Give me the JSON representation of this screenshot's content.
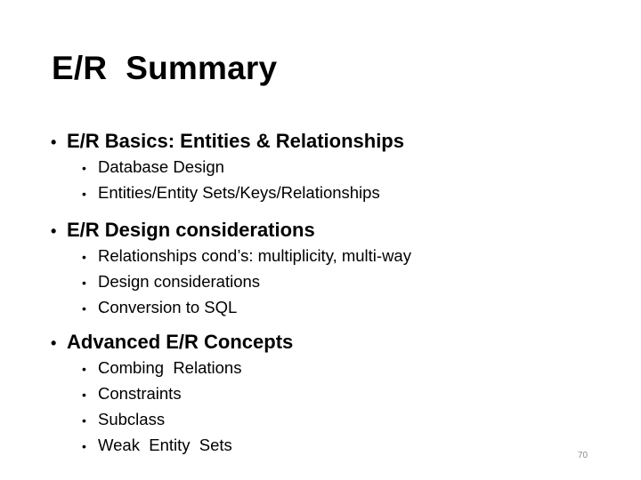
{
  "slide": {
    "title": "E/R  Summary",
    "page_number": "70",
    "sections": [
      {
        "heading": "E/R Basics: Entities & Relationships",
        "items": [
          "Database Design",
          "Entities/Entity Sets/Keys/Relationships"
        ]
      },
      {
        "heading": "E/R Design considerations",
        "items": [
          "Relationships cond’s: multiplicity, multi-way",
          "Design considerations",
          "Conversion to SQL"
        ]
      },
      {
        "heading": "Advanced E/R Concepts",
        "items": [
          "Combing  Relations",
          "Constraints",
          "Subclass",
          "Weak  Entity  Sets"
        ]
      }
    ],
    "bullet_glyph": "•"
  }
}
